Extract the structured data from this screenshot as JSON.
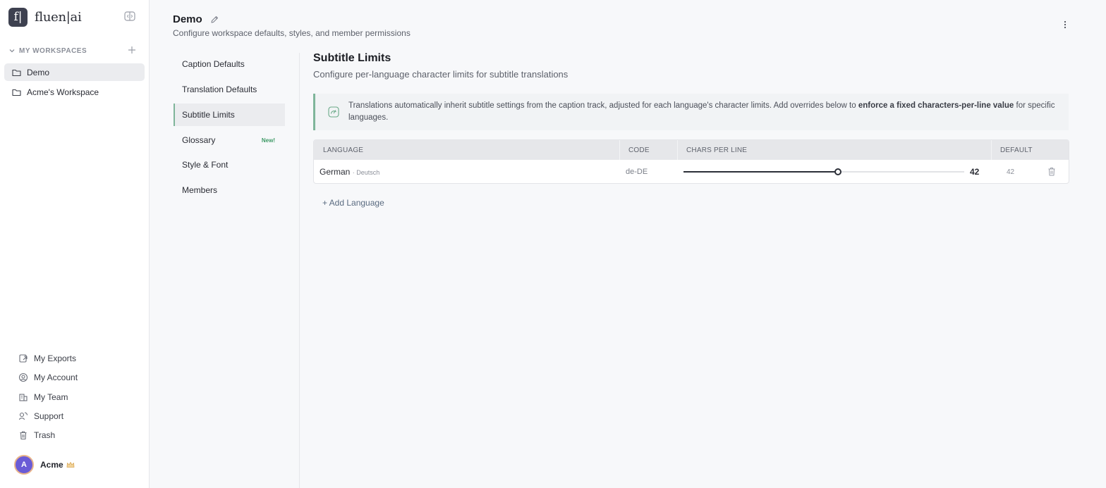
{
  "brand": {
    "logo_mark": "f|",
    "logo_text": "fluen|ai"
  },
  "workspaces": {
    "header": "MY WORKSPACES",
    "items": [
      {
        "label": "Demo",
        "active": true
      },
      {
        "label": "Acme's Workspace",
        "active": false
      }
    ]
  },
  "bottom_nav": [
    {
      "label": "My Exports",
      "icon": "exports-icon"
    },
    {
      "label": "My Account",
      "icon": "account-icon"
    },
    {
      "label": "My Team",
      "icon": "team-icon"
    },
    {
      "label": "Support",
      "icon": "support-icon"
    },
    {
      "label": "Trash",
      "icon": "trash-icon"
    }
  ],
  "user": {
    "initial": "A",
    "name": "Acme"
  },
  "header": {
    "title": "Demo",
    "subtitle": "Configure workspace defaults, styles, and member permissions"
  },
  "settings_nav": [
    {
      "label": "Caption Defaults"
    },
    {
      "label": "Translation Defaults"
    },
    {
      "label": "Subtitle Limits",
      "active": true
    },
    {
      "label": "Glossary",
      "badge": "New!"
    },
    {
      "label": "Style & Font"
    },
    {
      "label": "Members"
    }
  ],
  "section": {
    "title": "Subtitle Limits",
    "subtitle": "Configure per-language character limits for subtitle translations"
  },
  "info": {
    "text_before": "Translations automatically inherit subtitle settings from the caption track, adjusted for each language's character limits. Add overrides below to ",
    "text_bold": "enforce a fixed characters-per-line value",
    "text_after": " for specific languages."
  },
  "table": {
    "headers": {
      "language": "LANGUAGE",
      "code": "CODE",
      "cpl": "CHARS PER LINE",
      "default": "DEFAULT"
    },
    "rows": [
      {
        "language": "German",
        "native": "· Deutsch",
        "code": "de-DE",
        "cpl_value": "42",
        "slider_fraction": 0.55,
        "default": "42"
      }
    ]
  },
  "add_language_label": "+ Add Language",
  "colors": {
    "accent": "#7fb59a",
    "badge_green": "#3f9a66",
    "avatar_bg": "#6a5bd6"
  }
}
